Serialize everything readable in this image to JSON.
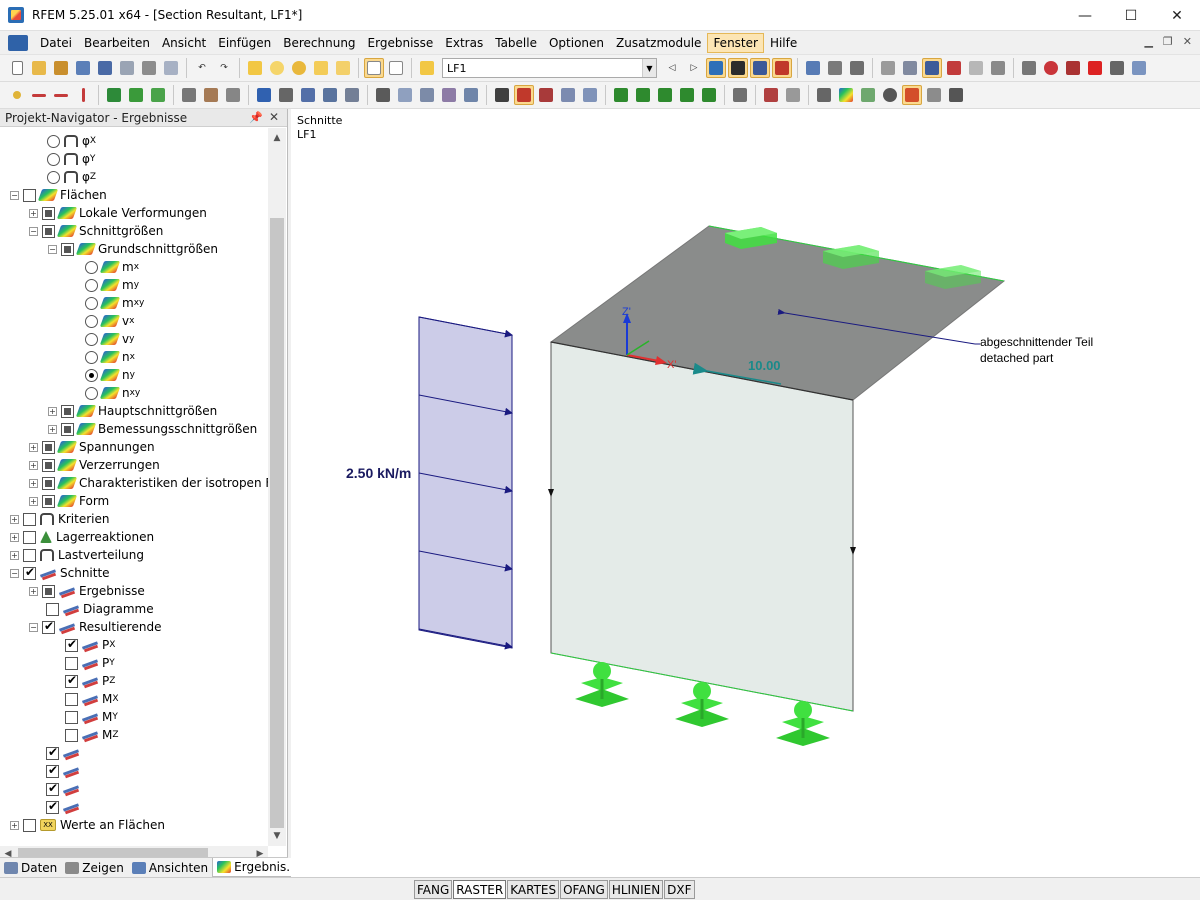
{
  "window": {
    "title": "RFEM 5.25.01 x64 - [Section Resultant, LF1*]",
    "controls": {
      "minimize": "—",
      "maximize": "☐",
      "close": "✕"
    }
  },
  "menu": [
    {
      "label": "Datei"
    },
    {
      "label": "Bearbeiten"
    },
    {
      "label": "Ansicht"
    },
    {
      "label": "Einfügen"
    },
    {
      "label": "Berechnung"
    },
    {
      "label": "Ergebnisse"
    },
    {
      "label": "Extras"
    },
    {
      "label": "Tabelle"
    },
    {
      "label": "Optionen"
    },
    {
      "label": "Zusatzmodule"
    },
    {
      "label": "Fenster"
    },
    {
      "label": "Hilfe"
    }
  ],
  "toolbar": {
    "load_case": "LF1"
  },
  "navigator": {
    "title": "Projekt-Navigator - Ergebnisse",
    "tree": {
      "phi_x": "φ",
      "phi_x_sub": "X",
      "phi_y": "φ",
      "phi_y_sub": "Y",
      "phi_z": "φ",
      "phi_z_sub": "Z",
      "flaechen": "Flächen",
      "lokale_verformungen": "Lokale Verformungen",
      "schnittgroessen": "Schnittgrößen",
      "grundschnittgroessen": "Grundschnittgrößen",
      "mx": "m",
      "mx_sub": "x",
      "my": "m",
      "my_sub": "y",
      "mxy": "m",
      "mxy_sub": "xy",
      "vx": "v",
      "vx_sub": "x",
      "vy": "v",
      "vy_sub": "y",
      "nx": "n",
      "nx_sub": "x",
      "ny": "n",
      "ny_sub": "y",
      "nxy": "n",
      "nxy_sub": "xy",
      "hauptschnittgroessen": "Hauptschnittgrößen",
      "bemessungsschnittgroessen": "Bemessungsschnittgrößen",
      "spannungen": "Spannungen",
      "verzerrungen": "Verzerrungen",
      "charakteristiken": "Charakteristiken der isotropen Fläc",
      "form": "Form",
      "kriterien": "Kriterien",
      "lagerreaktionen": "Lagerreaktionen",
      "lastverteilung": "Lastverteilung",
      "schnitte": "Schnitte",
      "ergebnisse": "Ergebnisse",
      "diagramme": "Diagramme",
      "resultierende": "Resultierende",
      "px": "P",
      "px_sub": "X",
      "py": "P",
      "py_sub": "Y",
      "pz": "P",
      "pz_sub": "Z",
      "mxr": "M",
      "mxr_sub": "X",
      "myr": "M",
      "myr_sub": "Y",
      "mzr": "M",
      "mzr_sub": "Z",
      "werte_an_flaechen": "Werte an Flächen"
    },
    "tabs": [
      "Daten",
      "Zeigen",
      "Ansichten",
      "Ergebnis..."
    ]
  },
  "viewport": {
    "header_line1": "Schnitte",
    "header_line2": "LF1",
    "load_label": "2.50 kN/m",
    "value_label": "10.00",
    "annotation_line1": "abgeschnittender Teil",
    "annotation_line2": "detached part",
    "axis_z": "Z'",
    "axis_x": "X'"
  },
  "statusbar": [
    "FANG",
    "RASTER",
    "KARTES",
    "OFANG",
    "HLINIEN",
    "DXF"
  ],
  "colors": {
    "accent_highlight": "#fbd98f",
    "load_fill": "#cccce8",
    "load_stroke": "#1a1a80",
    "wall_fill": "#e4ebe8",
    "top_face": "#8a8c8b",
    "support_green": "#40e040",
    "result_teal": "#1a8a8a"
  }
}
